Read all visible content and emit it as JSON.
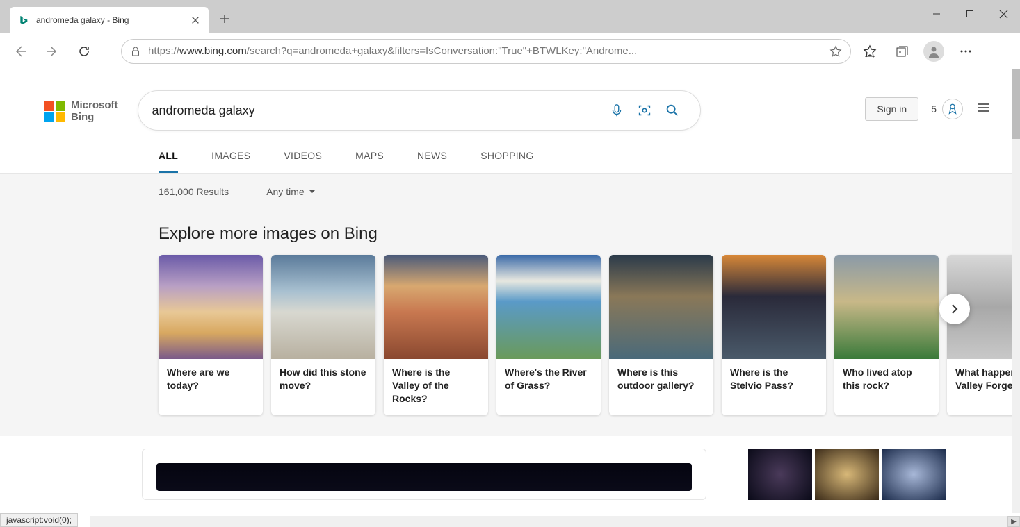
{
  "tab": {
    "title": "andromeda galaxy - Bing"
  },
  "url_prefix": "https://",
  "url_host": "www.bing.com",
  "url_path": "/search?q=andromeda+galaxy&filters=IsConversation:\"True\"+BTWLKey:\"Androme...",
  "logo": {
    "line1": "Microsoft",
    "line2": "Bing"
  },
  "search": {
    "query": "andromeda galaxy"
  },
  "signin": "Sign in",
  "rewards_count": "5",
  "tabs": [
    "ALL",
    "IMAGES",
    "VIDEOS",
    "MAPS",
    "NEWS",
    "SHOPPING"
  ],
  "active_tab": 0,
  "results_count": "161,000 Results",
  "time_filter": "Any time",
  "explore_heading": "Explore more images on Bing",
  "cards": [
    {
      "title": "Where are we today?"
    },
    {
      "title": "How did this stone move?"
    },
    {
      "title": "Where is the Valley of the Rocks?"
    },
    {
      "title": "Where's the River of Grass?"
    },
    {
      "title": "Where is this outdoor gallery?"
    },
    {
      "title": "Where is the Stelvio Pass?"
    },
    {
      "title": "Who lived atop this rock?"
    },
    {
      "title": "What happened at Valley Forge?"
    }
  ],
  "status": "javascript:void(0);"
}
